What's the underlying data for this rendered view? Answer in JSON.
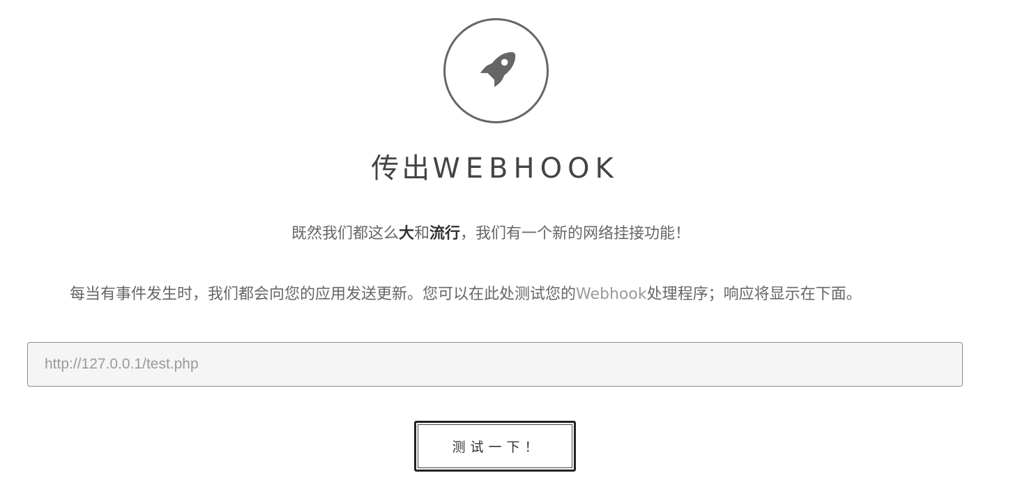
{
  "logo": {
    "icon": "rocket-icon",
    "color": "#666666"
  },
  "title": {
    "cjk": "传出",
    "latin": "WEBHOOK"
  },
  "intro": {
    "part1": "既然我们都这么",
    "bold1": "大",
    "part2": "和",
    "bold2": "流行",
    "part3": "，我们有一个新的网络挂接功能！"
  },
  "description": {
    "part1": "每当有事件发生时，我们都会向您的应用发送更新。您可以在此处测试您的",
    "highlight": "Webhook",
    "part2": "处理程序；响应将显示在下面。"
  },
  "url_field": {
    "value": "",
    "placeholder": "http://127.0.0.1/test.php"
  },
  "test_button": {
    "label": "测试一下！"
  }
}
